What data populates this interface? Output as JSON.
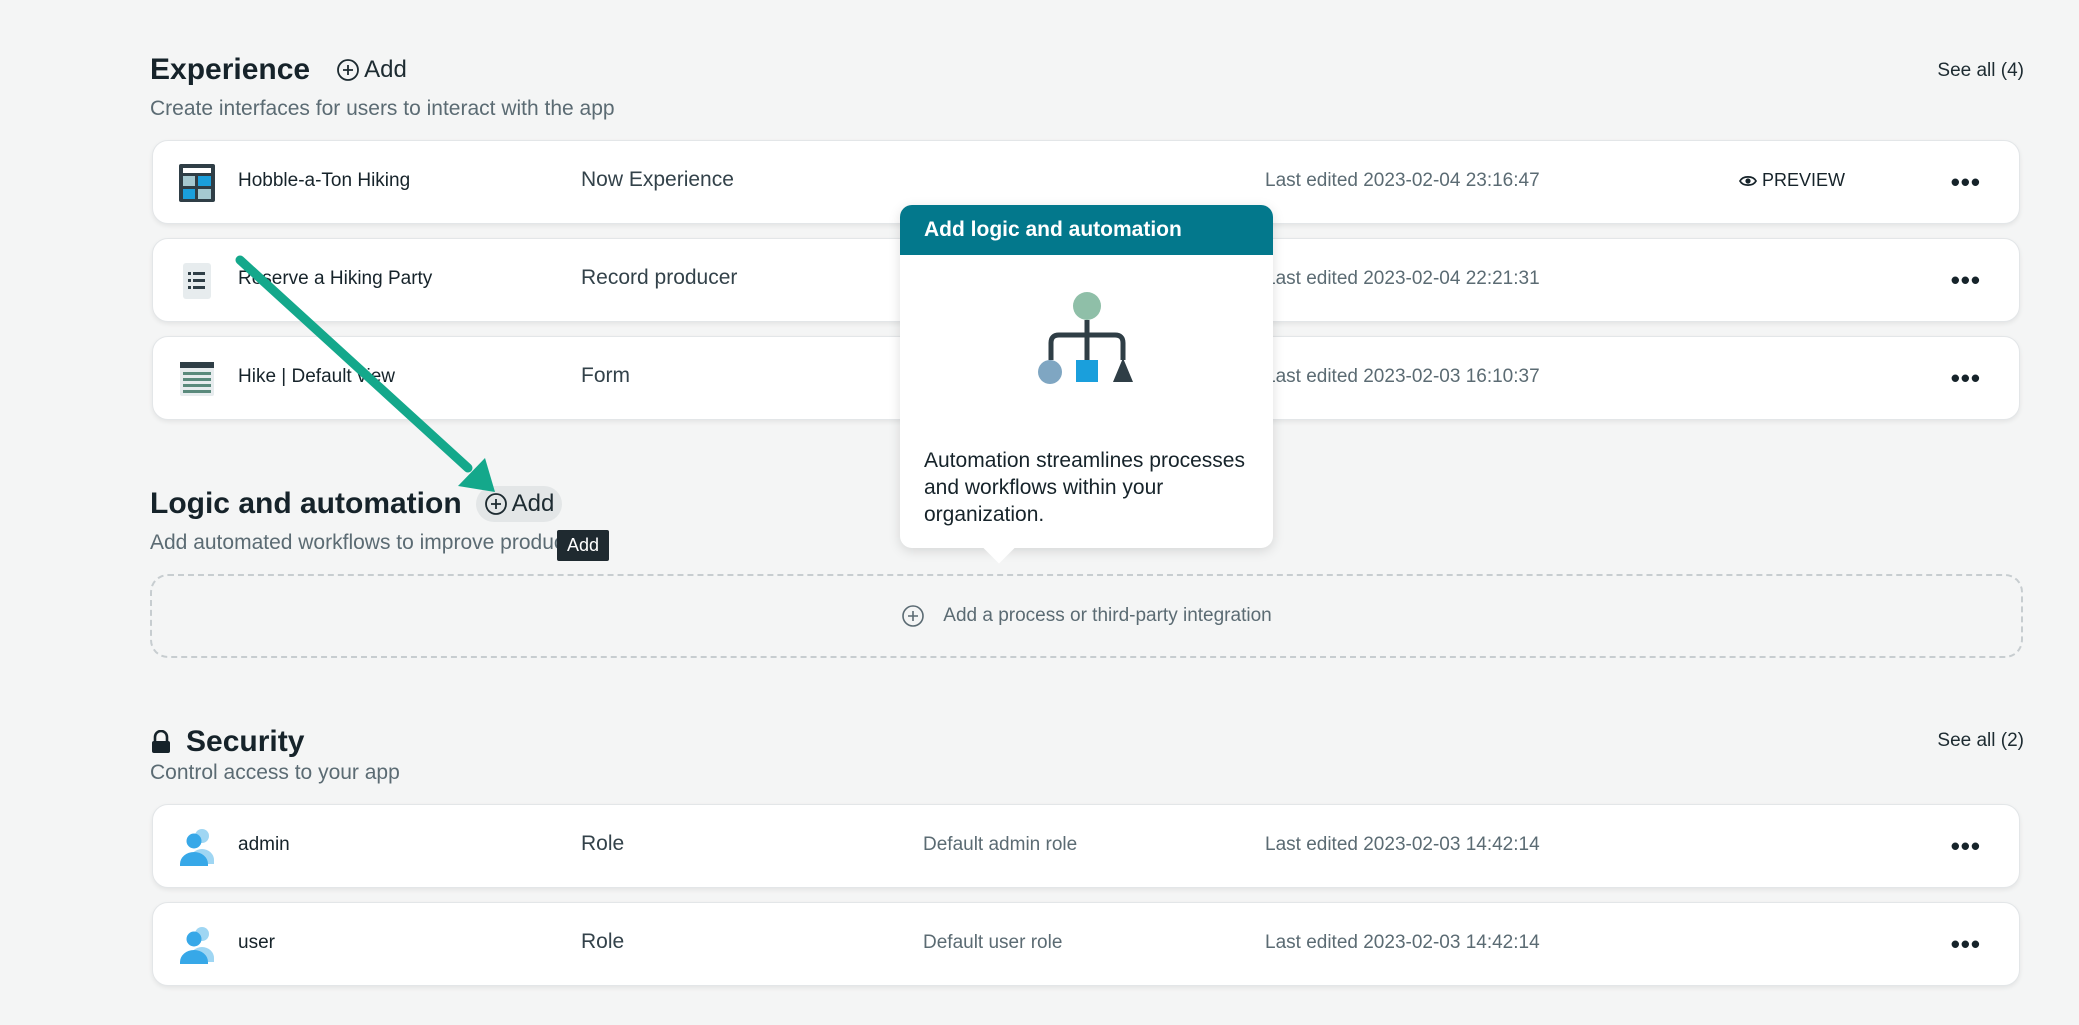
{
  "experience": {
    "title": "Experience",
    "add_label": "Add",
    "subtitle": "Create interfaces for users to interact with the app",
    "see_all": "See all (4)",
    "items": [
      {
        "name": "Hobble-a-Ton Hiking",
        "type": "Now Experience",
        "description": "",
        "edited": "Last edited 2023-02-04 23:16:47",
        "preview": "PREVIEW",
        "icon": "portal-icon"
      },
      {
        "name": "Reserve a Hiking Party",
        "type": "Record producer",
        "description": "",
        "edited": "Last edited 2023-02-04 22:21:31",
        "icon": "document-icon"
      },
      {
        "name": "Hike | Default view",
        "type": "Form",
        "description": "",
        "edited": "Last edited 2023-02-03 16:10:37",
        "icon": "form-icon"
      }
    ]
  },
  "logic": {
    "title": "Logic and automation",
    "add_label": "Add",
    "subtitle": "Add automated workflows to improve productivity",
    "add_process_label": "Add a process or third-party integration",
    "tooltip": "Add"
  },
  "popover": {
    "title": "Add logic and automation",
    "body": "Automation streamlines processes and workflows within your organization."
  },
  "security": {
    "title": "Security",
    "subtitle": "Control access to your app",
    "see_all": "See all (2)",
    "items": [
      {
        "name": "admin",
        "type": "Role",
        "description": "Default admin role",
        "edited": "Last edited 2023-02-03 14:42:14",
        "icon": "users-icon"
      },
      {
        "name": "user",
        "type": "Role",
        "description": "Default user role",
        "edited": "Last edited 2023-02-03 14:42:14",
        "icon": "users-icon"
      }
    ]
  },
  "colors": {
    "accent": "#03788c",
    "annotation_arrow": "#14a88b",
    "page_bg": "#f4f5f5"
  }
}
